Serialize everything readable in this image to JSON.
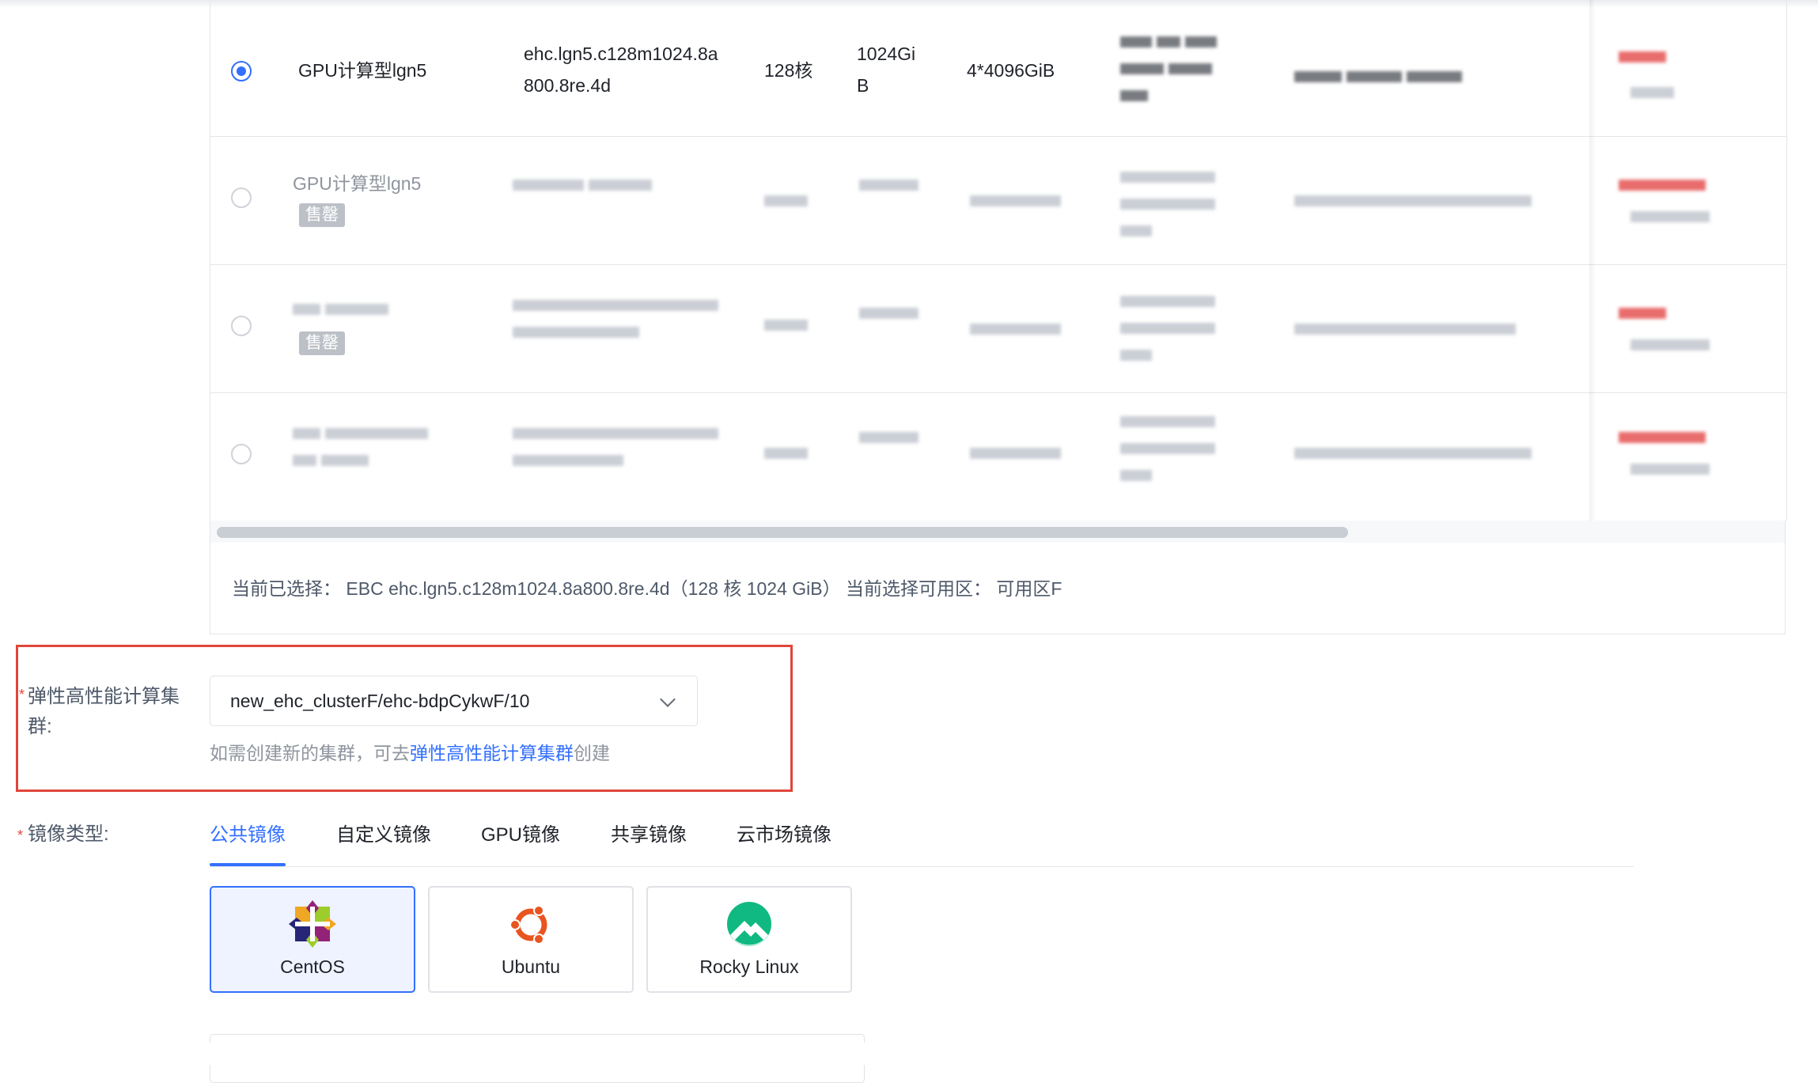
{
  "flavor_table": {
    "rows": [
      {
        "selected": true,
        "name": "GPU计算型lgn5",
        "spec_line1": "ehc.lgn5.c128m1024.8a",
        "spec_line2": "800.8re.4d",
        "vcpu": "128核",
        "mem_line1": "1024Gi",
        "mem_line2": "B",
        "disk": "4*4096GiB",
        "sold_out": ""
      },
      {
        "selected": false,
        "name": "GPU计算型lgn5",
        "sold_out": "售罄"
      },
      {
        "selected": false,
        "name": "",
        "sold_out": "售罄"
      },
      {
        "selected": false,
        "name": "",
        "sold_out": ""
      }
    ]
  },
  "summary": {
    "text": "当前已选择： EBC ehc.lgn5.c128m1024.8a800.8re.4d（128 核 1024 GiB） 当前选择可用区： 可用区F"
  },
  "cluster": {
    "required_mark": "*",
    "label_line1": "弹性高性能计算集",
    "label_line2": "群:",
    "selected_value": "new_ehc_clusterF/ehc-bdpCykwF/10",
    "hint_prefix": "如需创建新的集群，可去",
    "hint_link": "弹性高性能计算集群",
    "hint_suffix": "创建"
  },
  "image_type": {
    "required_mark": "*",
    "label": "镜像类型:",
    "tabs": [
      "公共镜像",
      "自定义镜像",
      "GPU镜像",
      "共享镜像",
      "云市场镜像"
    ],
    "active_tab": "公共镜像",
    "os_options": [
      {
        "label": "CentOS",
        "icon": "centos-icon",
        "selected": true
      },
      {
        "label": "Ubuntu",
        "icon": "ubuntu-icon",
        "selected": false
      },
      {
        "label": "Rocky Linux",
        "icon": "rocky-linux-icon",
        "selected": false
      }
    ]
  },
  "colors": {
    "accent": "#3370ff",
    "highlight_box": "#e0463b"
  }
}
